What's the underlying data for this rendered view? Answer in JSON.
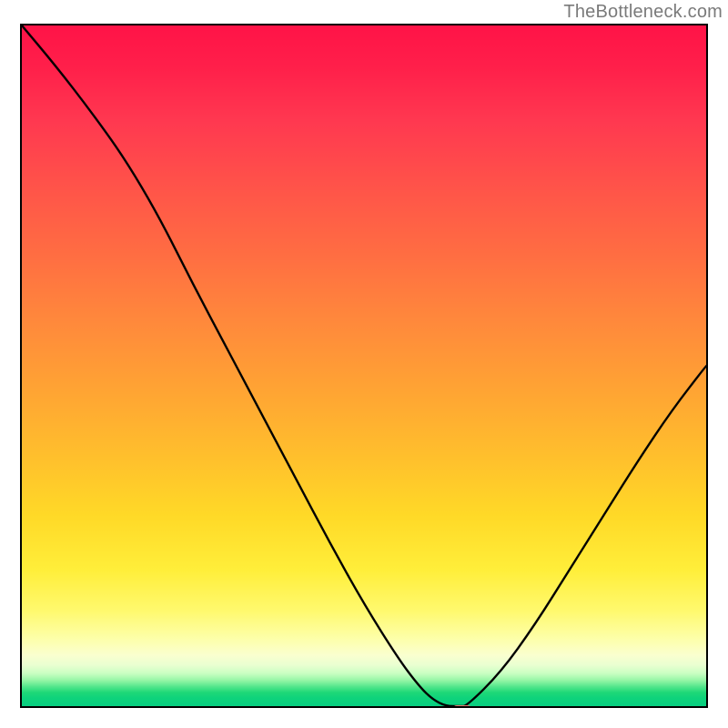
{
  "watermark": "TheBottleneck.com",
  "colors": {
    "top": "#ff1347",
    "mid": "#ffc12c",
    "bottom_green": "#08cf80",
    "curve": "#000000",
    "marker": "#e07a6e",
    "border": "#000000"
  },
  "chart_data": {
    "type": "line",
    "title": "",
    "xlabel": "",
    "ylabel": "",
    "xlim": [
      0,
      100
    ],
    "ylim": [
      0,
      100
    ],
    "grid": false,
    "legend": false,
    "annotations": [
      {
        "text": "TheBottleneck.com",
        "position": "top-right"
      }
    ],
    "series": [
      {
        "name": "bottleneck-curve",
        "x": [
          0,
          5,
          10,
          15,
          20,
          25,
          30,
          35,
          40,
          45,
          50,
          55,
          58,
          60,
          62,
          64,
          65,
          70,
          75,
          80,
          85,
          90,
          95,
          100
        ],
        "y": [
          100,
          94,
          87.5,
          80.5,
          72,
          62,
          52.5,
          43,
          33.5,
          24,
          15,
          7,
          3,
          1,
          0,
          0,
          0,
          5,
          12,
          20,
          28,
          36,
          43.5,
          50
        ]
      }
    ],
    "marker": {
      "x": 64,
      "y": 0
    },
    "background_gradient_description": "vertical heat map from red (high bottleneck) through orange/yellow to green (no bottleneck)"
  }
}
